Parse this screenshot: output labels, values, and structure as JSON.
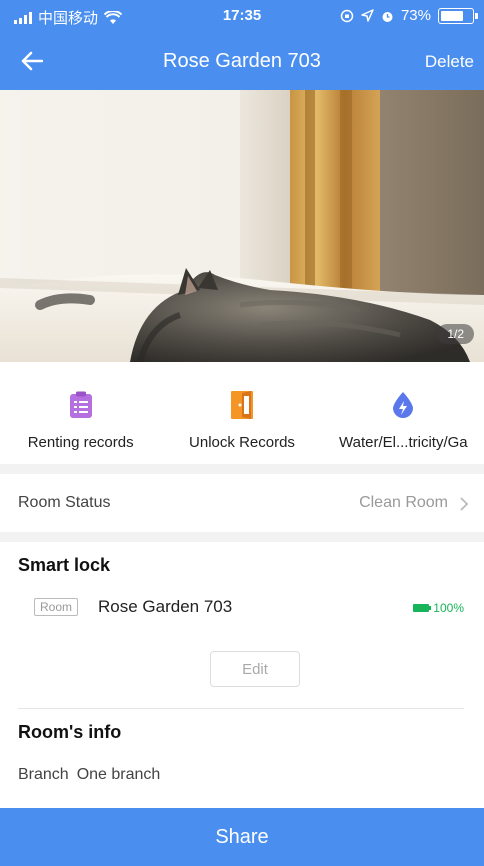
{
  "status_bar": {
    "carrier": "中国移动",
    "time": "17:35",
    "battery_percent": "73%",
    "battery_level": 0.73
  },
  "nav": {
    "title": "Rose Garden 703",
    "delete_label": "Delete",
    "back_icon": "arrow-left-icon"
  },
  "photo": {
    "page_indicator": "1/2"
  },
  "actions": [
    {
      "label": "Renting records",
      "icon": "clipboard-icon",
      "color": "#b56fe0"
    },
    {
      "label": "Unlock Records",
      "icon": "door-icon",
      "color": "#f59526"
    },
    {
      "label": "Water/El...tricity/Ga",
      "icon": "water-drop-icon",
      "color": "#5a78ec"
    }
  ],
  "room_status": {
    "label": "Room Status",
    "value": "Clean Room"
  },
  "smart_lock": {
    "title": "Smart lock",
    "tag": "Room",
    "room_name": "Rose Garden 703",
    "battery": "100%",
    "battery_color": "#18b45a",
    "edit_label": "Edit"
  },
  "room_info": {
    "title": "Room's info",
    "branch_label": "Branch",
    "branch_value": "One branch"
  },
  "share_label": "Share",
  "colors": {
    "primary": "#4a8fef"
  }
}
